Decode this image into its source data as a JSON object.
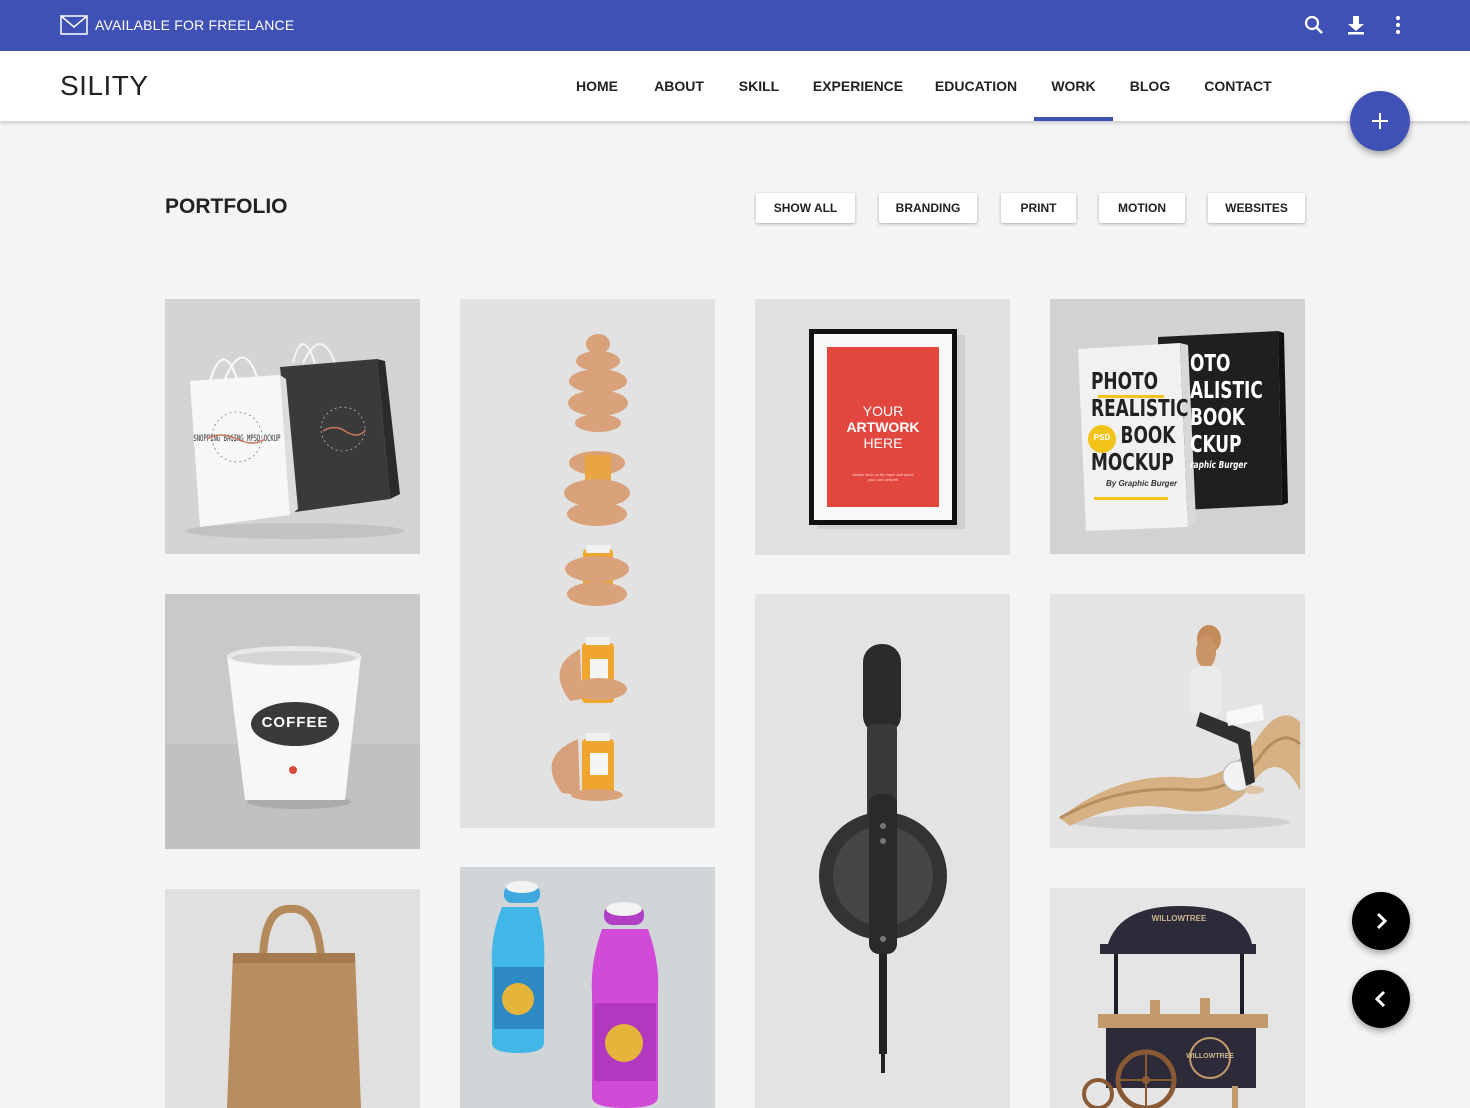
{
  "topbar": {
    "freelance": "AVAILABLE FOR FREELANCE",
    "color": "#3f51b5"
  },
  "header": {
    "logo": "SILITY",
    "nav": [
      "HOME",
      "ABOUT",
      "SKILL",
      "EXPERIENCE",
      "EDUCATION",
      "WORK",
      "BLOG",
      "CONTACT"
    ],
    "active": "WORK"
  },
  "portfolio": {
    "title": "PORTFOLIO",
    "filters": [
      "SHOW ALL",
      "BRANDING",
      "PRINT",
      "MOTION",
      "WEBSITES"
    ]
  },
  "items": {
    "bags": {
      "art": "SNOPPING BAGING MPSD OCKUP"
    },
    "frame": {
      "l1": "YOUR",
      "l2": "ARTWORK",
      "l3": "HERE",
      "small": "double click on the layer and place your own artwork"
    },
    "book": {
      "l1": "PHOTO",
      "l2": "REALISTIC",
      "l3": "BOOK",
      "l4": "MOCKUP",
      "badge": "PSD",
      "by": "By Graphic Burger",
      "back1": "OTO",
      "back2": "ALISTIC",
      "back3": "BOOK",
      "back4": "CKUP",
      "back5": "raphic Burger"
    },
    "cup": {
      "label": "COFFEE"
    },
    "cart": {
      "label": "WILLOWTREE"
    }
  },
  "icons": [
    "mail-icon",
    "search-icon",
    "download-icon",
    "more-vert-icon",
    "plus-icon",
    "chevron-right-icon",
    "chevron-left-icon"
  ]
}
